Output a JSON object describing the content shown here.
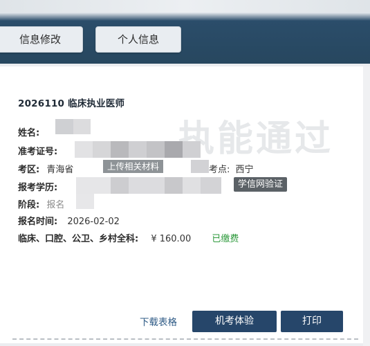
{
  "toolbar": {
    "edit_label": "信息修改",
    "personal_label": "个人信息"
  },
  "exam": {
    "title": "2026110 临床执业医师"
  },
  "fields": {
    "name_label": "姓名:",
    "ticket_label": "准考证号:",
    "region_label": "考区:",
    "region_value": "青海省",
    "site_label_partial": "考点:",
    "site_value": "西宁",
    "education_label": "报考学历:",
    "stage_label": "阶段:",
    "stage_value": "报名",
    "time_label": "报名时间:",
    "time_value": "2026-02-02",
    "fee_label": "临床、口腔、公卫、乡村全科:",
    "fee_amount": "¥ 160.00",
    "fee_status": "已缴费"
  },
  "overlay": {
    "upload_tag": "上传相关材料",
    "verify_badge": "学信网验证"
  },
  "watermark": "执能通过",
  "actions": {
    "download_label": "下载表格",
    "exam_experience_label": "机考体验",
    "print_label": "打印"
  },
  "colors": {
    "header_bg": "#27475f",
    "primary_button": "#26466a",
    "paid_green": "#2e9a3c",
    "link_blue": "#2f5b86"
  }
}
